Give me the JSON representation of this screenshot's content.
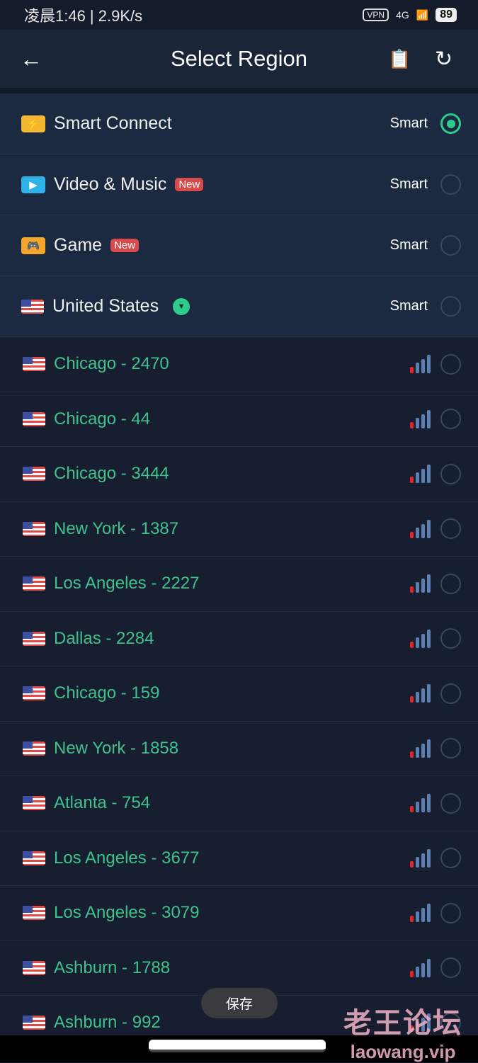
{
  "status_bar": {
    "time": "凌晨1:46 | 2.9K/s",
    "vpn": "VPN",
    "network": "4G",
    "battery": "89"
  },
  "header": {
    "title": "Select Region",
    "back_icon": "arrow-left-icon",
    "log_icon": "document-location-icon",
    "refresh_icon": "refresh-icon"
  },
  "top_items": [
    {
      "label": "Smart Connect",
      "icon": "lightning-icon",
      "icon_color": "#f5b731",
      "value": "Smart",
      "selected": true
    },
    {
      "label": "Video & Music",
      "icon": "play-icon",
      "icon_color": "#2fb2ea",
      "badge": "New",
      "value": "Smart",
      "selected": false
    },
    {
      "label": "Game",
      "icon": "gamepad-icon",
      "icon_color": "#f5a52a",
      "badge": "New",
      "value": "Smart",
      "selected": false
    },
    {
      "label": "United States",
      "icon": "us-flag-icon",
      "value": "Smart",
      "selected": false,
      "expanded": true
    }
  ],
  "servers": [
    {
      "label": "Chicago - 2470",
      "signal_bars": 1
    },
    {
      "label": "Chicago - 44",
      "signal_bars": 1
    },
    {
      "label": "Chicago - 3444",
      "signal_bars": 1
    },
    {
      "label": "New York - 1387",
      "signal_bars": 1
    },
    {
      "label": "Los Angeles - 2227",
      "signal_bars": 1
    },
    {
      "label": "Dallas - 2284",
      "signal_bars": 1
    },
    {
      "label": "Chicago - 159",
      "signal_bars": 1
    },
    {
      "label": "New York - 1858",
      "signal_bars": 1
    },
    {
      "label": "Atlanta - 754",
      "signal_bars": 1
    },
    {
      "label": "Los Angeles - 3677",
      "signal_bars": 1
    },
    {
      "label": "Los Angeles - 3079",
      "signal_bars": 1
    },
    {
      "label": "Ashburn - 1788",
      "signal_bars": 1
    },
    {
      "label": "Ashburn - 992",
      "signal_bars": 1
    }
  ],
  "toast": "保存",
  "watermark": {
    "title": "老王论坛",
    "url": "laowang.vip"
  },
  "colors": {
    "accent": "#2ecb8a",
    "server_text": "#3fc18c",
    "signal_weak": "#e0262a",
    "badge": "#d94a4a"
  }
}
